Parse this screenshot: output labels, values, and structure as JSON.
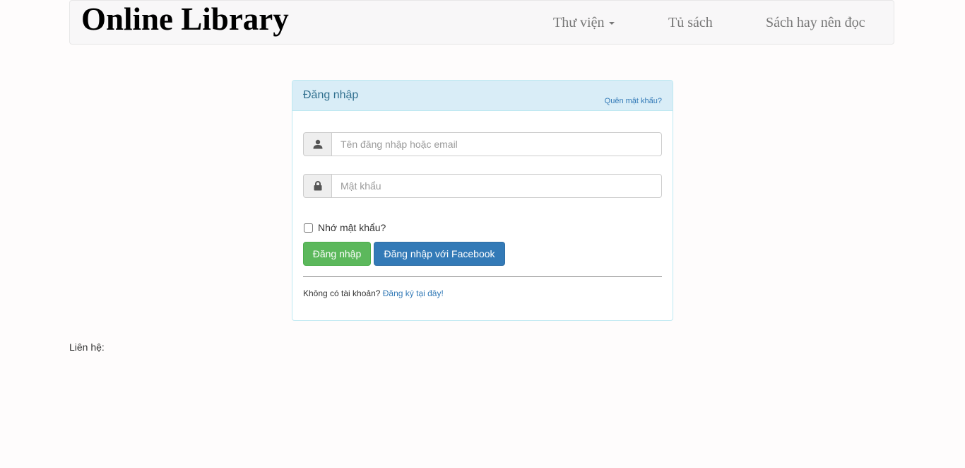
{
  "navbar": {
    "brand": "Online Library",
    "items": [
      {
        "label": "Thư viện",
        "has_dropdown": true
      },
      {
        "label": "Tủ sách"
      },
      {
        "label": "Sách hay nên đọc"
      }
    ]
  },
  "login_panel": {
    "title": "Đăng nhập",
    "forgot_password": "Quên mật khẩu?",
    "username": {
      "icon": "user-icon",
      "value": "",
      "placeholder": "Tên đăng nhập hoặc email"
    },
    "password": {
      "icon": "lock-icon",
      "value": "",
      "placeholder": "Mật khẩu"
    },
    "remember_label": "Nhớ mật khẩu?",
    "remember_checked": false,
    "login_button": "Đăng nhập",
    "facebook_button": "Đăng nhập với Facebook",
    "no_account_text": "Không có tài khoản?",
    "register_link": "Đăng ký tại đây!"
  },
  "footer": {
    "contact_label": "Liên hệ:"
  },
  "colors": {
    "panel_heading_bg": "#d9edf7",
    "panel_title": "#31708f",
    "link": "#337ab7",
    "success": "#5cb85c",
    "primary": "#337ab7"
  }
}
